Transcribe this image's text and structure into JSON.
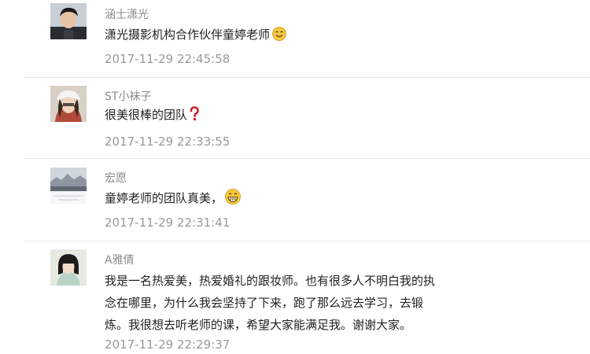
{
  "comments": [
    {
      "username": "涵士潇光",
      "lines": [
        "潇光摄影机构合作伙伴童婷老师"
      ],
      "emoji": "smile-emoji",
      "timestamp": "2017-11-29 22:45:58"
    },
    {
      "username": "ST小袜子",
      "lines": [
        "很美很棒的团队"
      ],
      "emoji": "question-mark-emoji",
      "timestamp": "2017-11-29 22:33:55"
    },
    {
      "username": "宏愿",
      "lines": [
        "童婷老师的团队真美，"
      ],
      "emoji": "grin-emoji",
      "timestamp": "2017-11-29 22:31:41"
    },
    {
      "username": "A雅倩",
      "lines": [
        "我是一名热爱美，热爱婚礼的跟妆师。也有很多人不明白我的执",
        "念在哪里，为什么我会坚持了下来，跑了那么远去学习，去锻",
        "炼。我很想去听老师的课，希望大家能满足我。谢谢大家。"
      ],
      "emoji": "",
      "timestamp": "2017-11-29 22:29:37"
    }
  ],
  "colors": {
    "username": "#8a8a8a",
    "content": "#222222",
    "timestamp": "#999999",
    "divider": "#e6e6e6",
    "question_mark": "#d0232a",
    "emoji_yellow": "#f5c842"
  }
}
